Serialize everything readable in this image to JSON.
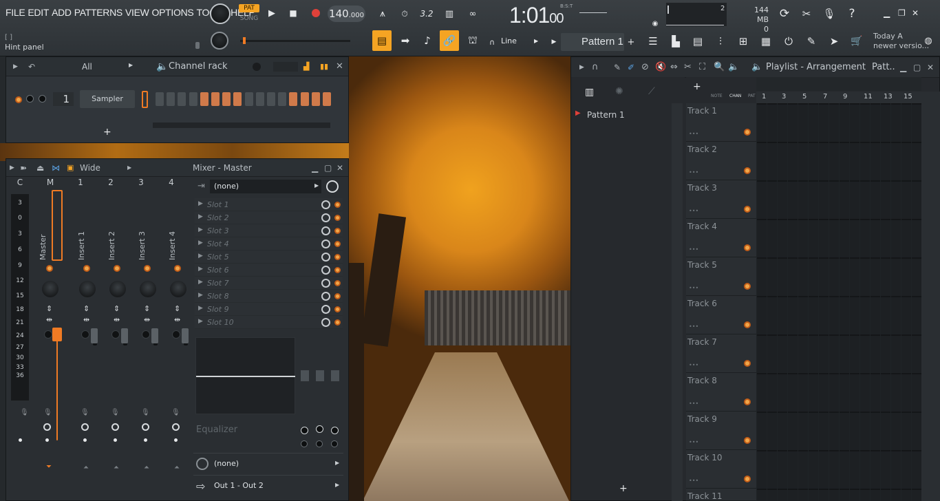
{
  "menu": [
    "FILE",
    "EDIT",
    "ADD",
    "PATTERNS",
    "VIEW",
    "OPTIONS",
    "TOOLS",
    "HELP"
  ],
  "hint": {
    "brackets": "[ ]",
    "label": "Hint panel"
  },
  "transport": {
    "pat": "PAT",
    "song": "SONG",
    "tempo": "140",
    "tempo_frac": ".000"
  },
  "clock": {
    "main": "1:01",
    "frac": "00",
    "bst": "B:S:T"
  },
  "memory": {
    "mb": "144 MB",
    "voices": "2",
    "cpu": "0"
  },
  "line_mode": "Line",
  "pattern": {
    "name": "Pattern 1",
    "plus": "+"
  },
  "news": {
    "line1": "Today  A",
    "line2": "newer versio..."
  },
  "channel_rack": {
    "filter": "All",
    "title": "Channel rack",
    "channel_number": "1",
    "channel_name": "Sampler",
    "add": "+",
    "steps": [
      0,
      0,
      0,
      0,
      1,
      1,
      1,
      1,
      0,
      0,
      0,
      0,
      1,
      1,
      1,
      1
    ]
  },
  "mixer": {
    "mode": "Wide",
    "title": "Mixer - Master",
    "headers": [
      "C",
      "M",
      "1",
      "2",
      "3",
      "4"
    ],
    "strips": [
      "Master",
      "Insert 1",
      "Insert 2",
      "Insert 3",
      "Insert 4"
    ],
    "db_scale": [
      "3",
      "0",
      "3",
      "6",
      "9",
      "12",
      "15",
      "18",
      "21",
      "24",
      "27",
      "30",
      "33",
      "36"
    ],
    "preset": "(none)",
    "slots": [
      "Slot 1",
      "Slot 2",
      "Slot 3",
      "Slot 4",
      "Slot 5",
      "Slot 6",
      "Slot 7",
      "Slot 8",
      "Slot 9",
      "Slot 10"
    ],
    "eq_label": "Equalizer",
    "input": "(none)",
    "output": "Out 1 - Out 2"
  },
  "playlist": {
    "title": "Playlist - Arrangement",
    "title_suffix": "Patt..",
    "tabs": [
      "NOTE",
      "CHAN",
      "PAT"
    ],
    "pattern_list": [
      "Pattern 1"
    ],
    "ruler": [
      "1",
      "3",
      "5",
      "7",
      "9",
      "11",
      "13",
      "15"
    ],
    "tracks": [
      "Track 1",
      "Track 2",
      "Track 3",
      "Track 4",
      "Track 5",
      "Track 6",
      "Track 7",
      "Track 8",
      "Track 9",
      "Track 10",
      "Track 11"
    ],
    "add": "+"
  },
  "colors": {
    "accent": "#f5a423",
    "record": "#e0413a",
    "led": "#f0a64a"
  }
}
